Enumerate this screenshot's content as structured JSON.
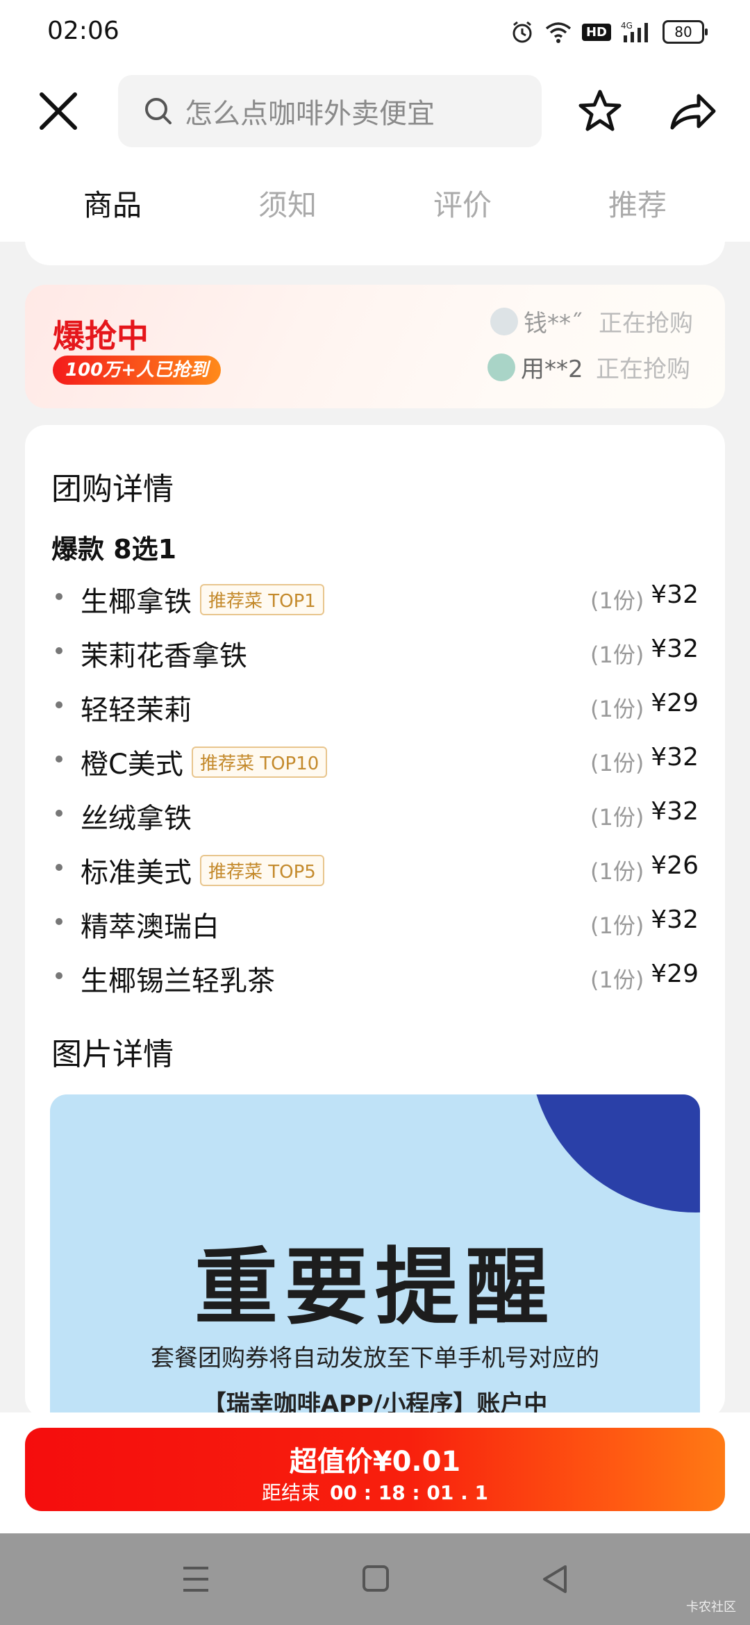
{
  "status_bar": {
    "time": "02:06",
    "hd": "HD",
    "network": "4G",
    "battery": "80"
  },
  "search": {
    "placeholder": "怎么点咖啡外卖便宜"
  },
  "tabs": [
    {
      "label": "商品",
      "active": true
    },
    {
      "label": "须知",
      "active": false
    },
    {
      "label": "评价",
      "active": false
    },
    {
      "label": "推荐",
      "active": false
    }
  ],
  "hot": {
    "title": "爆抢中",
    "badge": "100万+人已抢到",
    "buyers": [
      {
        "name": "钱**˝",
        "action": "正在抢购"
      },
      {
        "name": "用**2",
        "action": "正在抢购"
      }
    ]
  },
  "group": {
    "title": "团购详情",
    "subtitle": "爆款 8选1",
    "items": [
      {
        "name": "生椰拿铁",
        "tag": "推荐菜 TOP1",
        "qty": "(1份)",
        "price": "¥32"
      },
      {
        "name": "茉莉花香拿铁",
        "tag": "",
        "qty": "(1份)",
        "price": "¥32"
      },
      {
        "name": "轻轻茉莉",
        "tag": "",
        "qty": "(1份)",
        "price": "¥29"
      },
      {
        "name": "橙C美式",
        "tag": "推荐菜 TOP10",
        "qty": "(1份)",
        "price": "¥32"
      },
      {
        "name": "丝绒拿铁",
        "tag": "",
        "qty": "(1份)",
        "price": "¥32"
      },
      {
        "name": "标准美式",
        "tag": "推荐菜 TOP5",
        "qty": "(1份)",
        "price": "¥26"
      },
      {
        "name": "精萃澳瑞白",
        "tag": "",
        "qty": "(1份)",
        "price": "¥32"
      },
      {
        "name": "生椰锡兰轻乳茶",
        "tag": "",
        "qty": "(1份)",
        "price": "¥29"
      }
    ]
  },
  "image_details": {
    "title": "图片详情",
    "heading": "重要提醒",
    "line1": "套餐团购券将自动发放至下单手机号对应的",
    "line2": "【瑞幸咖啡APP/小程序】账户中"
  },
  "buy": {
    "price_label": "超值价¥0.01",
    "countdown_label": "距结束",
    "countdown": "00 : 18 : 01 . 1"
  },
  "watermark": "卡农社区",
  "colors": {
    "accent": "#e5161b",
    "tag": "#c48a2c",
    "button_start": "#f50d0d",
    "button_end": "#ff7a14"
  }
}
